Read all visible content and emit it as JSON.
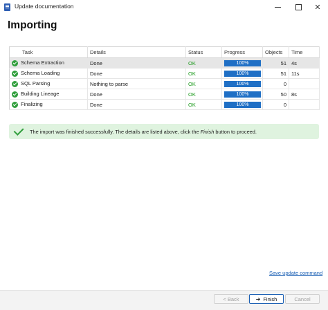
{
  "window": {
    "title": "Update documentation"
  },
  "heading": "Importing",
  "table": {
    "columns": [
      "Task",
      "Details",
      "Status",
      "Progress",
      "Objects",
      "Time"
    ],
    "rows": [
      {
        "task": "Schema Extraction",
        "details": "Done",
        "status": "OK",
        "progress_label": "100%",
        "progress_fraction": 1.0,
        "objects": "51",
        "time": "4s"
      },
      {
        "task": "Schema Loading",
        "details": "Done",
        "status": "OK",
        "progress_label": "100%",
        "progress_fraction": 1.0,
        "objects": "51",
        "time": "11s"
      },
      {
        "task": "SQL Parsing",
        "details": "Nothing to parse",
        "status": "OK",
        "progress_label": "100%",
        "progress_fraction": 1.0,
        "objects": "0",
        "time": ""
      },
      {
        "task": "Building Lineage",
        "details": "Done",
        "status": "OK",
        "progress_label": "100%",
        "progress_fraction": 1.0,
        "objects": "50",
        "time": "8s"
      },
      {
        "task": "Finalizing",
        "details": "Done",
        "status": "OK",
        "progress_label": "100%",
        "progress_fraction": 1.0,
        "objects": "0",
        "time": ""
      }
    ],
    "selected_row": 0
  },
  "message": {
    "before": "The import was finished successfully. The details are listed above, click the ",
    "emphasis": "Finish",
    "after": " button to proceed."
  },
  "link": "Save update command",
  "buttons": {
    "back": "< Back",
    "finish": "Finish",
    "cancel": "Cancel"
  },
  "colors": {
    "accent": "#1a5fb4",
    "progress": "#1f6fc5",
    "ok": "#1e9a1e",
    "success_bg": "#dff3df"
  }
}
